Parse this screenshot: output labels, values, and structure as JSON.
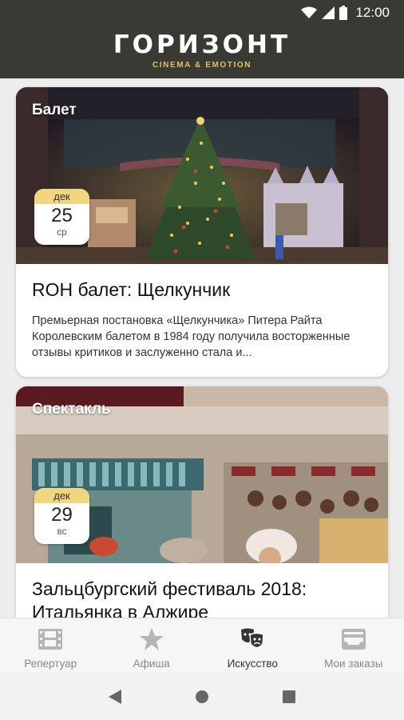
{
  "status_bar": {
    "time": "12:00"
  },
  "header": {
    "title": "ГОРИЗОНТ",
    "subtitle": "CINEMA & EMOTION"
  },
  "cards": [
    {
      "category": "Балет",
      "date": {
        "month": "дек",
        "day": "25",
        "weekday": "ср"
      },
      "title": "ROH балет: Щелкунчик",
      "description": "Премьерная постановка «Щелкунчика» Питера Райта Королевским балетом в 1984 году получила восторженные отзывы критиков и заслуженно стала и..."
    },
    {
      "category": "Спектакль",
      "date": {
        "month": "дек",
        "day": "29",
        "weekday": "вс"
      },
      "title": "Зальцбургский фестиваль 2018: Итальянка в Алжире"
    }
  ],
  "bottom_nav": {
    "items": [
      {
        "label": "Репертуар",
        "icon": "film-icon"
      },
      {
        "label": "Афиша",
        "icon": "star-icon"
      },
      {
        "label": "Искусство",
        "icon": "theater-masks-icon"
      },
      {
        "label": "Мои заказы",
        "icon": "tickets-icon"
      }
    ],
    "active_index": 2
  },
  "colors": {
    "header_bg": "#3a3a35",
    "accent_gold": "#e6c067",
    "date_month_bg": "#f2d57f"
  }
}
